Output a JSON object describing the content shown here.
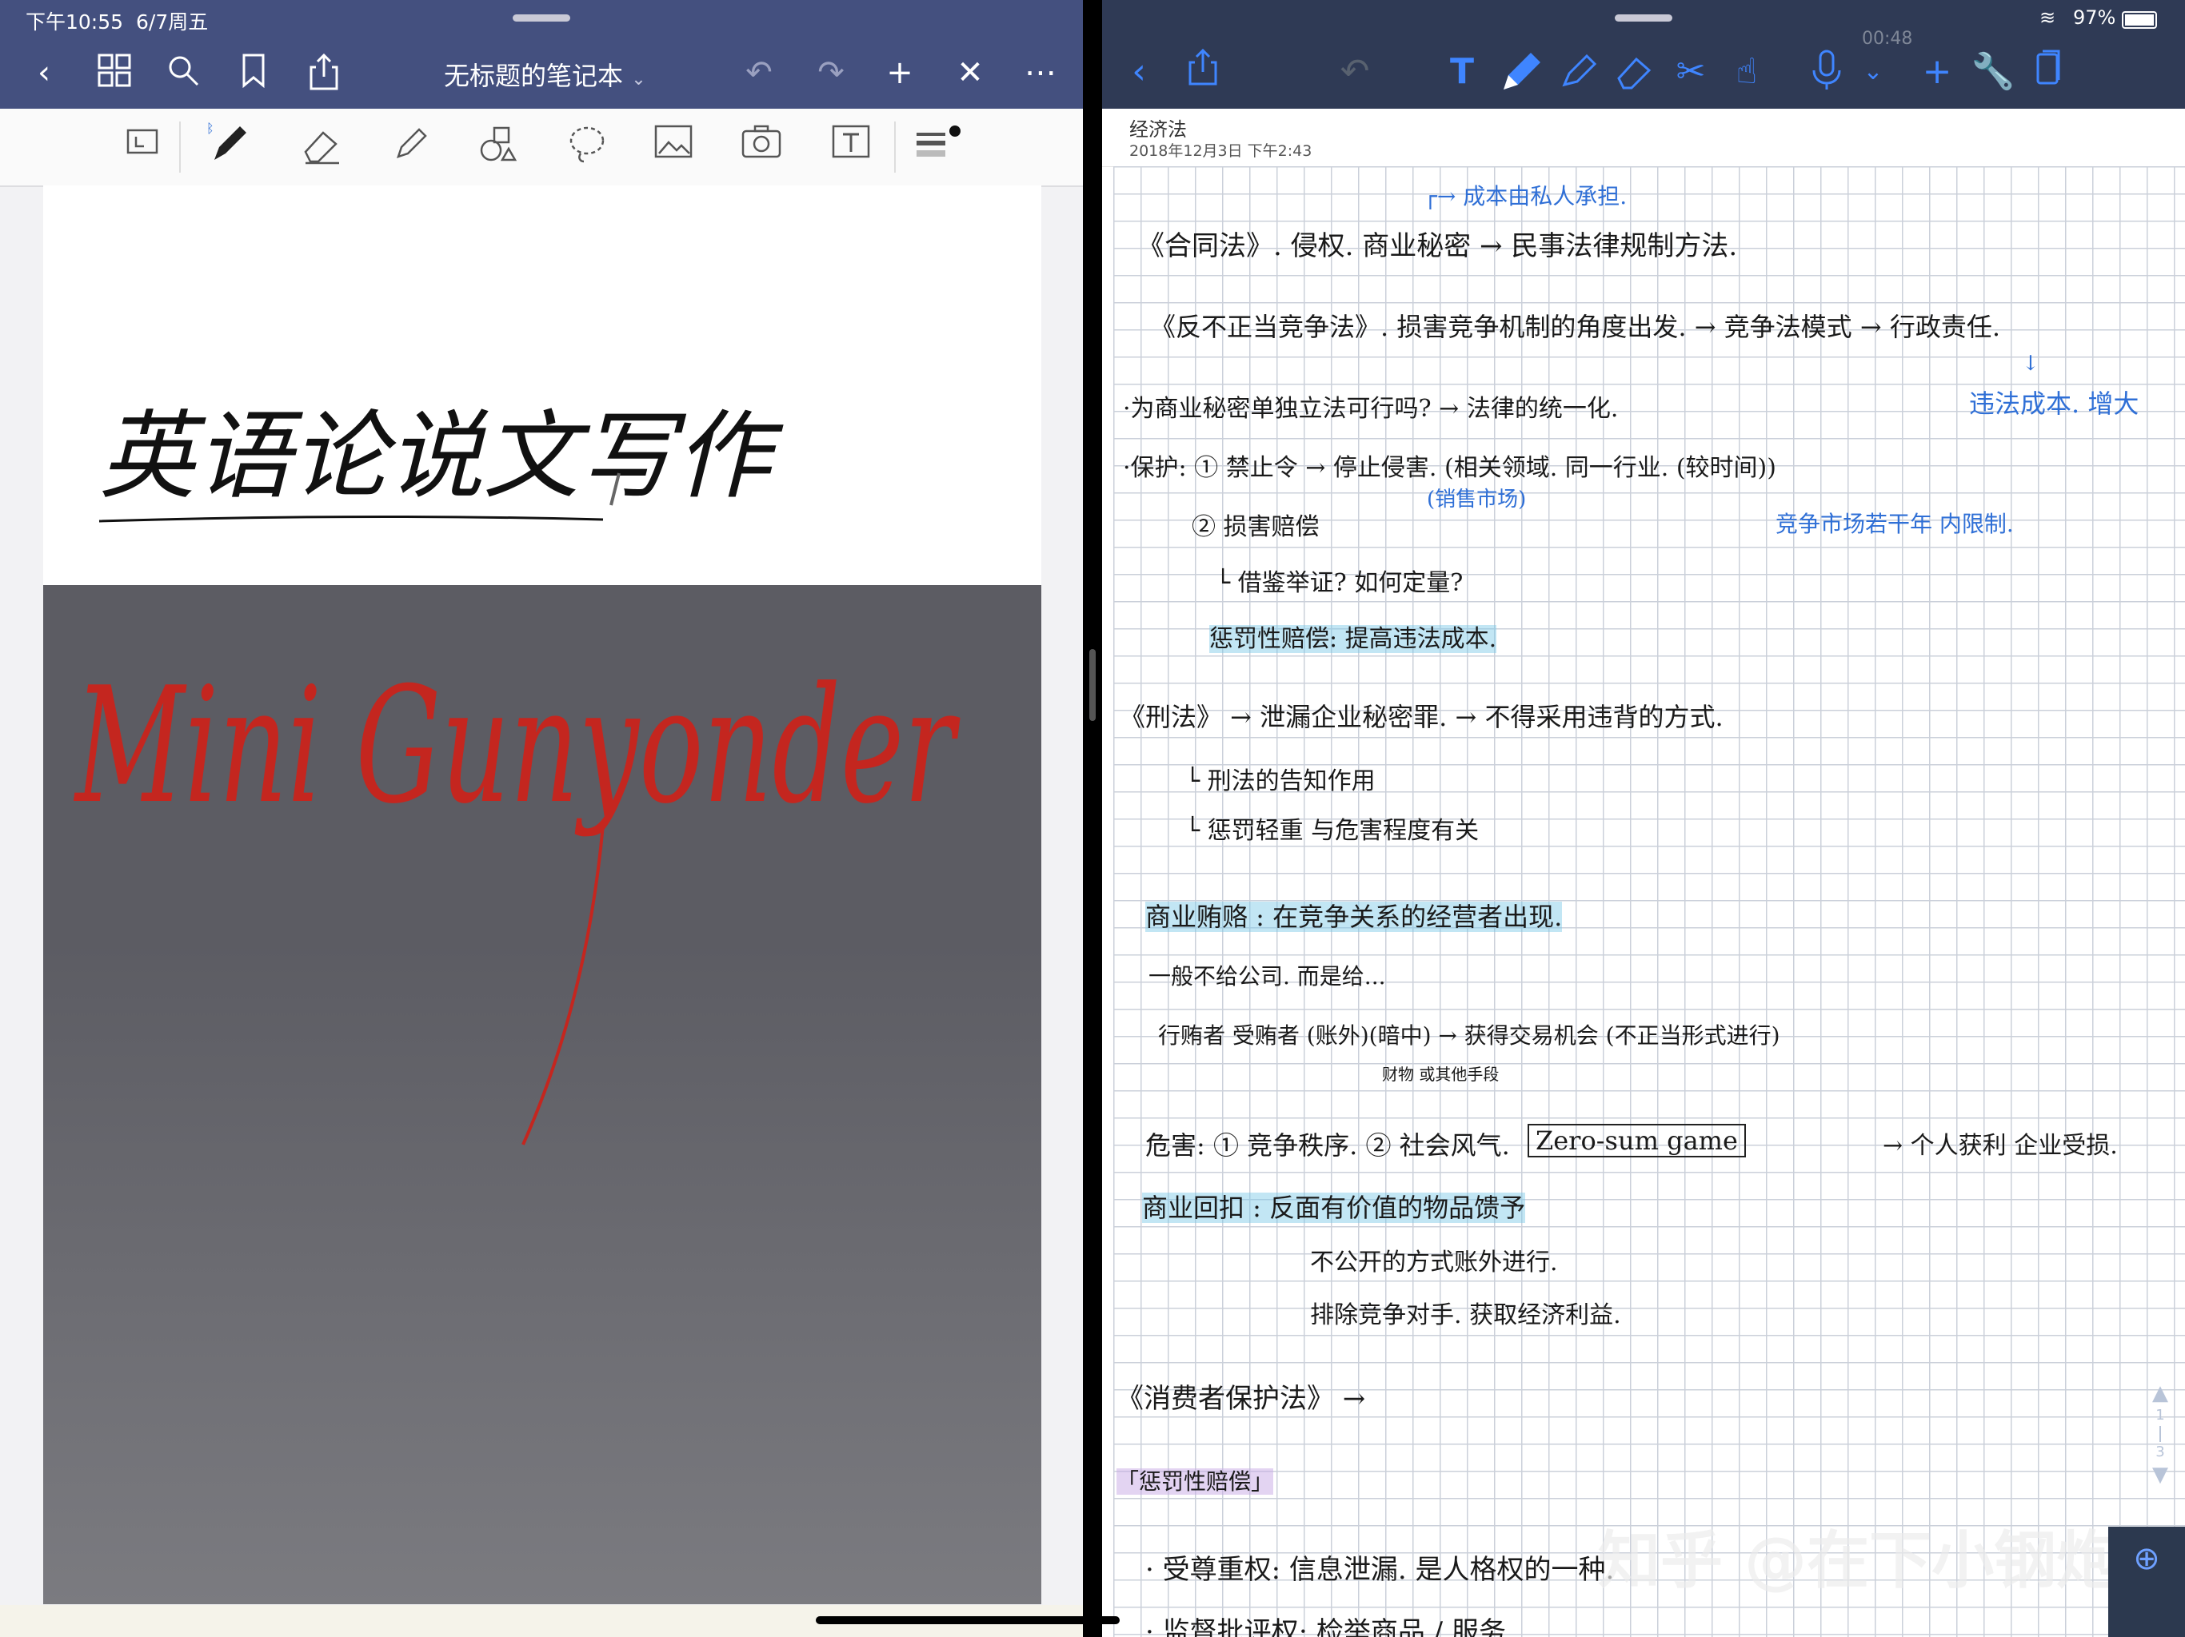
{
  "left": {
    "status": {
      "time": "下午10:55",
      "date": "6/7周五"
    },
    "notebook_title": "无标题的笔记本",
    "toolbar_icons": [
      "back-icon",
      "grid-icon",
      "search-icon",
      "bookmark-icon",
      "share-icon",
      "undo-icon",
      "redo-icon",
      "add-icon",
      "close-pen-icon",
      "more-icon"
    ],
    "tools": [
      "page-switch-icon",
      "pen-icon",
      "eraser-icon",
      "highlighter-icon",
      "shapes-icon",
      "lasso-icon",
      "image-icon",
      "camera-icon",
      "textbox-icon",
      "color-width-icon"
    ],
    "handwriting_title": "英语论说文写作",
    "handwriting_sig": "Mini Gunyonder"
  },
  "right": {
    "status": {
      "battery": "97%"
    },
    "record_time": "00:48",
    "note_title": "经济法",
    "note_date": "2018年12月3日 下午2:43",
    "page_indicator": {
      "current": "1",
      "total": "3"
    },
    "watermark": "知乎 @在下小钢炮",
    "lines": [
      {
        "t": "┌→ 成本由私人承担."
      },
      {
        "t": "《合同法》. 侵权. 商业秘密 → 民事法律规制方法."
      },
      {
        "t": "《反不正当竞争法》. 损害竞争机制的角度出发. → 竞争法模式 → 行政责任."
      },
      {
        "t": "↓"
      },
      {
        "t": "·为商业秘密单独立法可行吗? → 法律的统一化."
      },
      {
        "t": "违法成本. 增大"
      },
      {
        "t": "·保护: ① 禁止令 → 停止侵害. (相关领域. 同一行业. (较时间))"
      },
      {
        "t": "(销售市场)"
      },
      {
        "t": "② 损害赔偿"
      },
      {
        "t": "竞争市场若干年 内限制."
      },
      {
        "t": "└ 借鉴举证? 如何定量?"
      },
      {
        "t": "惩罚性赔偿: 提高违法成本."
      },
      {
        "t": "《刑法》 → 泄漏企业秘密罪. → 不得采用违背的方式."
      },
      {
        "t": "└ 刑法的告知作用"
      },
      {
        "t": "└ 惩罚轻重 与危害程度有关"
      },
      {
        "t": "商业贿赂 : 在竞争关系的经营者出现."
      },
      {
        "t": "一般不给公司. 而是给..."
      },
      {
        "t": "行贿者 受贿者 (账外)(暗中) → 获得交易机会 (不正当形式进行)"
      },
      {
        "t": "财物 或其他手段"
      },
      {
        "t": "危害: ① 竞争秩序. ② 社会风气. "
      },
      {
        "t": "Zero-sum game"
      },
      {
        "t": "→ 个人获利 企业受损."
      },
      {
        "t": "商业回扣 : 反面有价值的物品馈予"
      },
      {
        "t": "不公开的方式账外进行."
      },
      {
        "t": "排除竞争对手. 获取经济利益."
      },
      {
        "t": "《消费者保护法》 →"
      },
      {
        "t": "「惩罚性赔偿」"
      },
      {
        "t": "· 受尊重权: 信息泄漏. 是人格权的一种."
      },
      {
        "t": "· 监督批评权: 检举商品 / 服务..."
      }
    ]
  }
}
